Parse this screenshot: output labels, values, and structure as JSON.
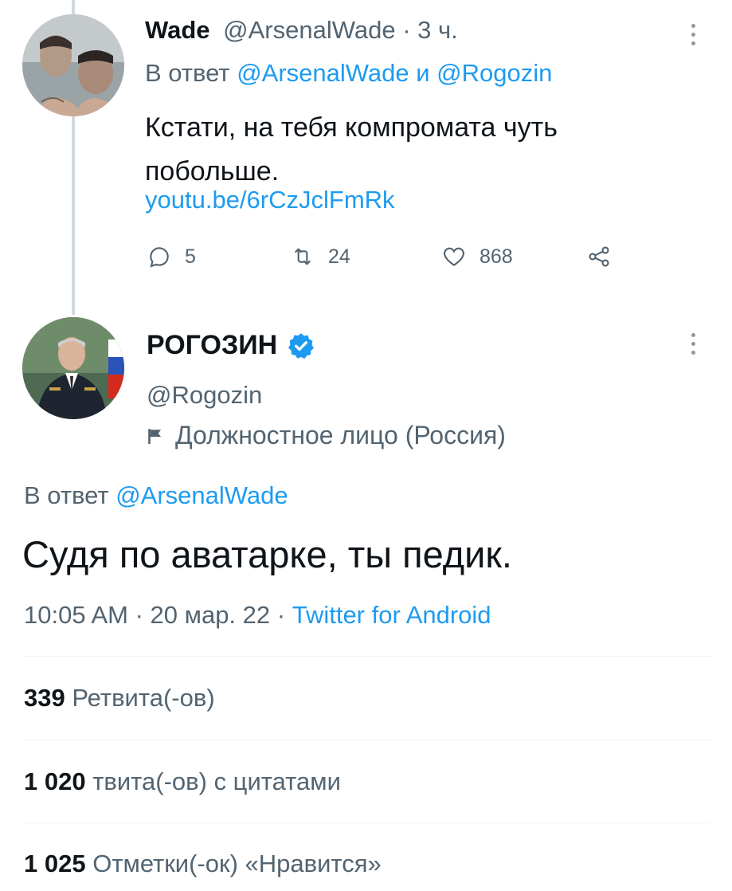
{
  "reply_tweet": {
    "author_name": "Wade",
    "author_handle": "@ArsenalWade",
    "separator": " · ",
    "time": "3 ч.",
    "reply_prefix": "В ответ ",
    "reply_to_1": "@ArsenalWade",
    "reply_join": " и ",
    "reply_to_2": "@Rogozin",
    "text": "Кстати, на тебя компромата чуть побольше.",
    "link": "youtu.be/6rCzJclFmRk",
    "actions": {
      "replies": "5",
      "retweets": "24",
      "likes": "868"
    },
    "icons": [
      "reply-icon",
      "retweet-icon",
      "like-icon",
      "share-icon",
      "more-icon"
    ]
  },
  "main_tweet": {
    "author_name": "РОГОЗИН",
    "author_handle": "@Rogozin",
    "account_label": "Должностное лицо (Россия)",
    "reply_prefix": "В ответ ",
    "reply_to": "@ArsenalWade",
    "text": "Судя по аватарке, ты педик.",
    "time": "10:05 AM",
    "separator": " · ",
    "date": "20 мар. 22",
    "source": "Twitter for Android",
    "stats": [
      {
        "count": "339",
        "label": "Ретвита(-ов)"
      },
      {
        "count": "1 020",
        "label": "твита(-ов) с цитатами"
      },
      {
        "count": "1 025",
        "label": "Отметки(-ок) «Нравится»"
      }
    ]
  },
  "colors": {
    "accent": "#1d9bf0",
    "secondary_text": "#536471",
    "primary_text": "#0f1419",
    "divider": "#eff3f4"
  }
}
